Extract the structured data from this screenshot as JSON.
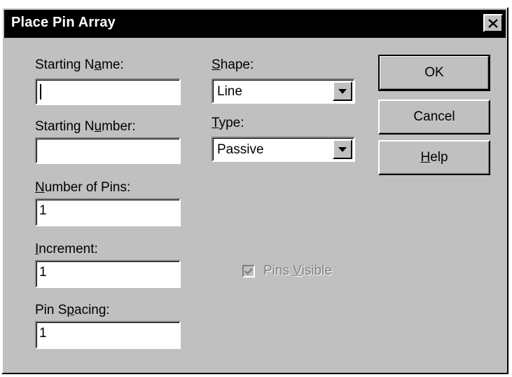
{
  "dialog": {
    "title": "Place Pin Array",
    "close_label": "×"
  },
  "fields": {
    "starting_name": {
      "label_pre": "Starting N",
      "label_accel": "a",
      "label_post": "me:",
      "value": ""
    },
    "starting_number": {
      "label_pre": "Starting N",
      "label_accel": "u",
      "label_post": "mber:",
      "value": ""
    },
    "number_of_pins": {
      "label_pre": "",
      "label_accel": "N",
      "label_post": "umber of Pins:",
      "value": "1"
    },
    "increment": {
      "label_pre": "",
      "label_accel": "I",
      "label_post": "ncrement:",
      "value": "1"
    },
    "pin_spacing": {
      "label_pre": "Pin S",
      "label_accel": "p",
      "label_post": "acing:",
      "value": "1"
    }
  },
  "shape": {
    "label_accel": "S",
    "label_post": "hape:",
    "value": "Line"
  },
  "type": {
    "label_accel": "T",
    "label_post": "ype:",
    "value": "Passive"
  },
  "pins_visible": {
    "label_pre": "Pins ",
    "label_accel": "V",
    "label_post": "isible",
    "checked": true,
    "enabled": false
  },
  "buttons": {
    "ok": "OK",
    "cancel": "Cancel",
    "help_accel": "H",
    "help_post": "elp"
  },
  "colors": {
    "dialog_face": "#c0c0c0",
    "titlebar": "#000000",
    "disabled_text": "#808080"
  }
}
